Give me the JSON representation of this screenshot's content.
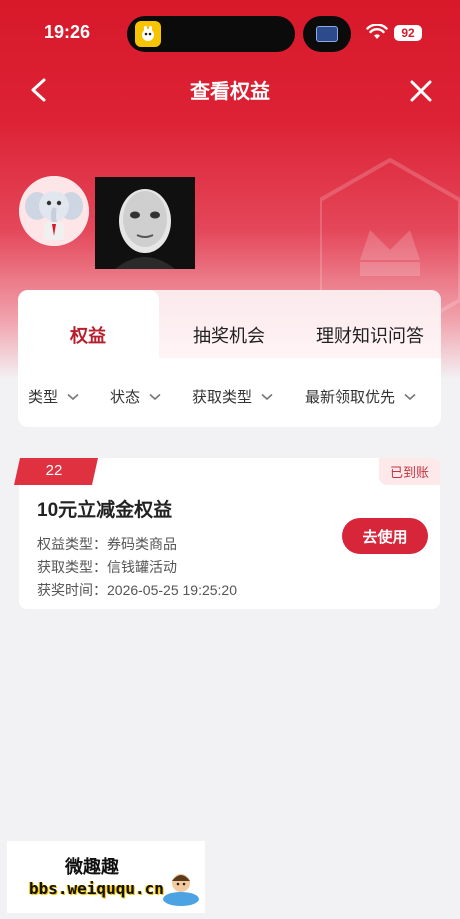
{
  "status_bar": {
    "time": "19:26",
    "battery": "92"
  },
  "nav": {
    "title": "查看权益"
  },
  "tabs": [
    {
      "label": "权益",
      "active": true
    },
    {
      "label": "抽奖机会",
      "active": false
    },
    {
      "label": "理财知识问答",
      "active": false
    }
  ],
  "filters": [
    {
      "label": "类型"
    },
    {
      "label": "状态"
    },
    {
      "label": "获取类型"
    },
    {
      "label": "最新领取优先"
    }
  ],
  "reward": {
    "badge": "22",
    "status": "已到账",
    "title": "10元立减金权益",
    "lines": [
      "权益类型：券码类商品",
      "获取类型：信钱罐活动",
      "获奖时间：2026-05-25 19:25:20"
    ],
    "button": "去使用"
  },
  "watermark": {
    "title": "微趣趣",
    "url": "bbs.weiququ.cn"
  },
  "colors": {
    "brand_red": "#d7192a",
    "active_tab": "#b81f2d",
    "button": "#d7263a"
  }
}
